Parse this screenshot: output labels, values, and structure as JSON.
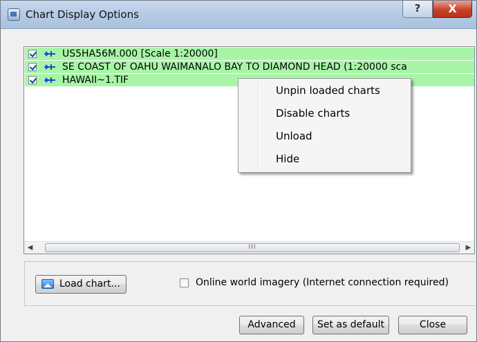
{
  "window": {
    "title": "Chart Display Options",
    "help_label": "?",
    "close_glyph": "X"
  },
  "charts": [
    {
      "label": "US5HA56M.000 [Scale 1:20000]",
      "checked": true,
      "pinned": true,
      "highlight_color": "#a8f5a8"
    },
    {
      "label": "SE COAST OF OAHU  WAIMANALO BAY TO DIAMOND HEAD (1:20000 sca",
      "checked": true,
      "pinned": true,
      "highlight_color": "#a8f5a8"
    },
    {
      "label": "HAWAII~1.TIF",
      "checked": true,
      "pinned": true,
      "highlight_color": "#a8f5a8"
    }
  ],
  "scrollbar": {
    "left_arrow": "◀",
    "right_arrow": "▶",
    "grip": "III"
  },
  "context_menu": {
    "items": [
      "Unpin loaded charts",
      "Disable charts",
      "Unload",
      "Hide"
    ]
  },
  "options": {
    "load_chart_label": "Load chart...",
    "online_imagery_label": "Online world imagery (Internet connection required)",
    "online_imagery_checked": false
  },
  "footer": {
    "advanced_label": "Advanced",
    "set_default_label": "Set as default",
    "close_label": "Close"
  }
}
